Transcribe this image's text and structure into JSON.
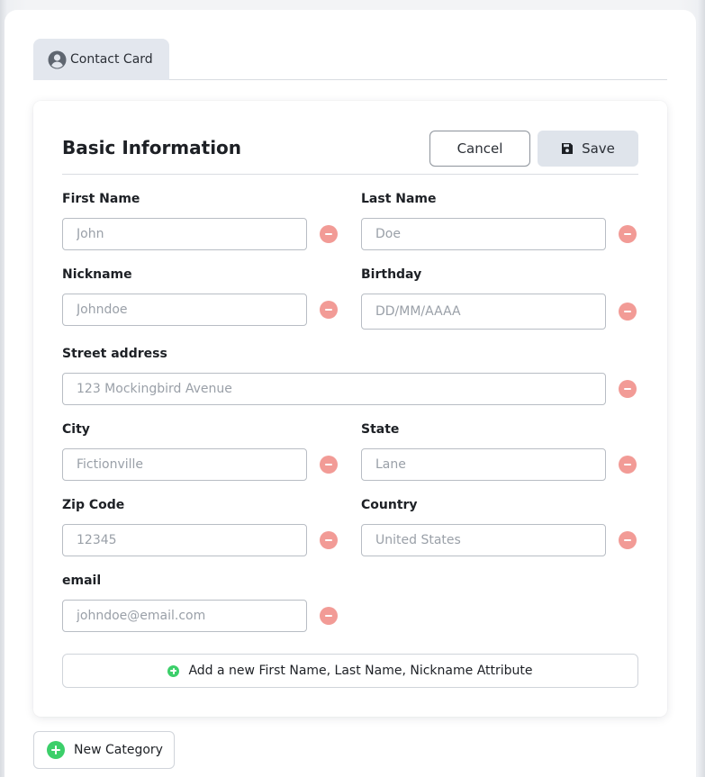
{
  "tab": {
    "label": "Contact Card",
    "icon": "user-circle-icon"
  },
  "section": {
    "title": "Basic Information",
    "cancel_label": "Cancel",
    "save_label": "Save"
  },
  "fields": {
    "first_name": {
      "label": "First Name",
      "placeholder": "John"
    },
    "last_name": {
      "label": "Last Name",
      "placeholder": "Doe"
    },
    "nickname": {
      "label": "Nickname",
      "placeholder": "Johndoe"
    },
    "birthday": {
      "label": "Birthday",
      "placeholder": "DD/MM/AAAA"
    },
    "street": {
      "label": "Street address",
      "placeholder": "123 Mockingbird Avenue"
    },
    "city": {
      "label": "City",
      "placeholder": "Fictionville"
    },
    "state": {
      "label": "State",
      "placeholder": "Lane"
    },
    "zip": {
      "label": "Zip Code",
      "placeholder": "12345"
    },
    "country": {
      "label": "Country",
      "placeholder": "United States"
    },
    "email": {
      "label": "email",
      "placeholder": "johndoe@email.com"
    }
  },
  "add_attribute_label": "Add a new First Name, Last Name, Nickname Attribute",
  "new_category_label": "New Category",
  "colors": {
    "remove": "#f29b96",
    "add": "#3ccf6a",
    "save_bg": "#dfe4eb",
    "tab_bg": "#e3e7ee"
  }
}
